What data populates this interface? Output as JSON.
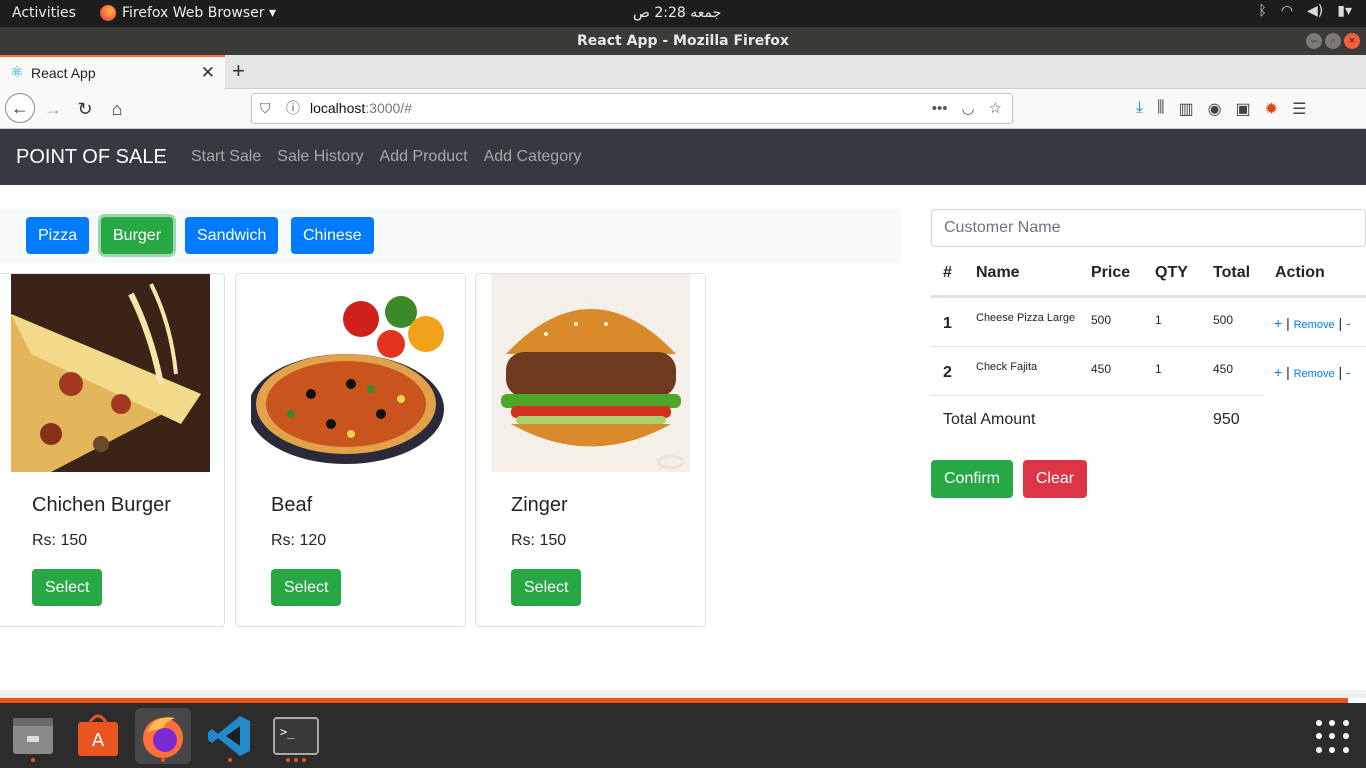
{
  "system": {
    "activities": "Activities",
    "app_menu": "Firefox Web Browser ▾",
    "clock": "جمعه  2:28 ص"
  },
  "window": {
    "title": "React App - Mozilla Firefox"
  },
  "browser": {
    "tab_title": "React App",
    "url_host": "localhost",
    "url_rest": ":3000/#"
  },
  "app": {
    "brand": "POINT OF SALE",
    "nav": [
      "Start Sale",
      "Sale History",
      "Add Product",
      "Add Category"
    ],
    "categories": [
      "Pizza",
      "Burger",
      "Sandwich",
      "Chinese"
    ],
    "active_category": "Burger",
    "products": [
      {
        "name": "Chichen Burger",
        "price": "Rs: 150",
        "button": "Select"
      },
      {
        "name": "Beaf",
        "price": "Rs: 120",
        "button": "Select"
      },
      {
        "name": "Zinger",
        "price": "Rs: 150",
        "button": "Select"
      }
    ],
    "customer_placeholder": "Customer Name",
    "cart_headers": [
      "#",
      "Name",
      "Price",
      "QTY",
      "Total",
      "Action"
    ],
    "cart_rows": [
      {
        "num": "1",
        "name": "Cheese Pizza Large",
        "price": "500",
        "qty": "1",
        "total": "500"
      },
      {
        "num": "2",
        "name": "Check Fajita",
        "price": "450",
        "qty": "1",
        "total": "450"
      }
    ],
    "action_plus": "+",
    "action_sep": "|",
    "action_remove": "Remove",
    "action_minus": "-",
    "total_label": "Total Amount",
    "total_value": "950",
    "confirm": "Confirm",
    "clear": "Clear"
  },
  "colors": {
    "primary": "#007bff",
    "success": "#28a745",
    "danger": "#dc3545",
    "navbar": "#343a40",
    "ubuntu_orange": "#e95420"
  }
}
